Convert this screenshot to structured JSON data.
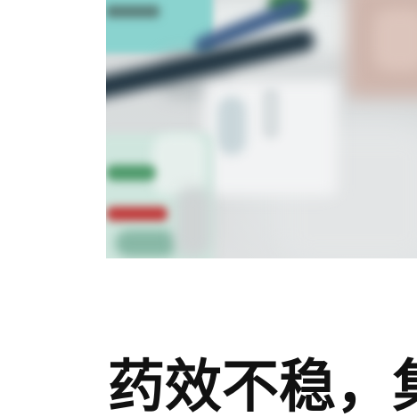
{
  "article": {
    "headline": "药效不稳，集"
  },
  "hero_image": {
    "description_colors": {
      "background": "#d9dcdd",
      "teal_label": "#8ad3cf",
      "navy_band": "#1f3340",
      "red_stripe": "#c0393a",
      "green_label": "#4f9a6b"
    }
  }
}
